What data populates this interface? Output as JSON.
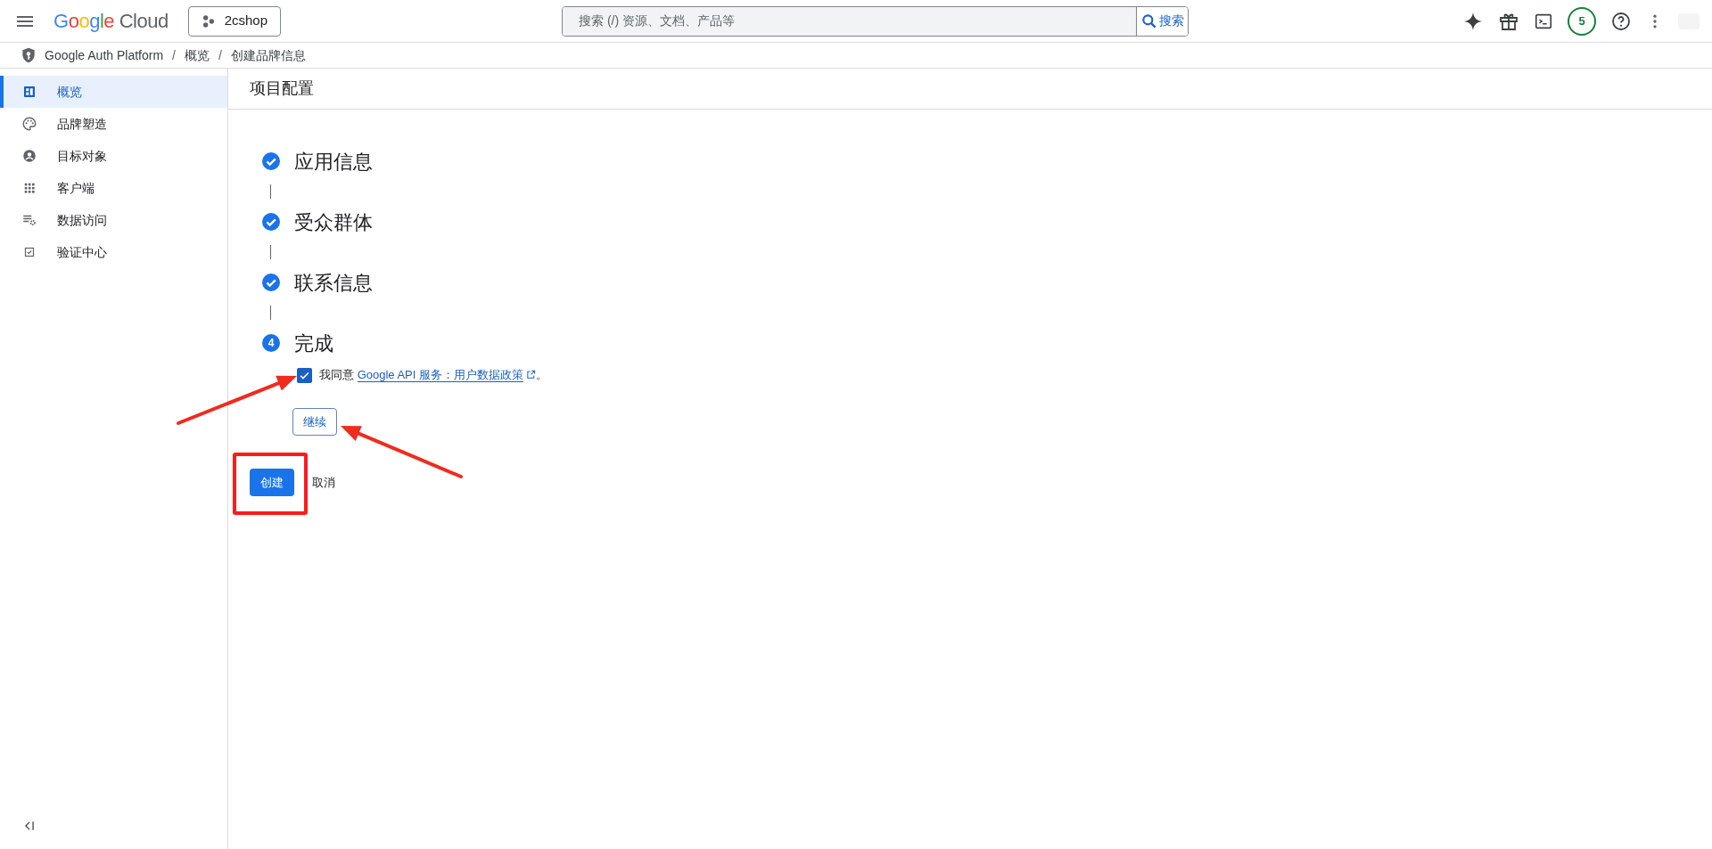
{
  "header": {
    "logo": "Google Cloud",
    "project": "2cshop",
    "search": {
      "placeholder": "搜索 (/) 资源、文档、产品等",
      "button": "搜索"
    },
    "notification_count": "5"
  },
  "breadcrumb": {
    "separator": "/",
    "items": [
      "Google Auth Platform",
      "概览",
      "创建品牌信息"
    ]
  },
  "sidebar": {
    "items": [
      {
        "label": "概览",
        "selected": true
      },
      {
        "label": "品牌塑造",
        "selected": false
      },
      {
        "label": "目标对象",
        "selected": false
      },
      {
        "label": "客户端",
        "selected": false
      },
      {
        "label": "数据访问",
        "selected": false
      },
      {
        "label": "验证中心",
        "selected": false
      }
    ]
  },
  "page_title": "项目配置",
  "steps": [
    {
      "title": "应用信息",
      "kind": "done"
    },
    {
      "title": "受众群体",
      "kind": "done"
    },
    {
      "title": "联系信息",
      "kind": "done"
    },
    {
      "title": "完成",
      "kind": "current",
      "number": "4"
    }
  ],
  "agreement": {
    "checked": true,
    "prefix": "我同意",
    "link": "Google API 服务：用户数据政策",
    "suffix": "。"
  },
  "continue_button": "继续",
  "create_button": "创建",
  "cancel_button": "取消"
}
